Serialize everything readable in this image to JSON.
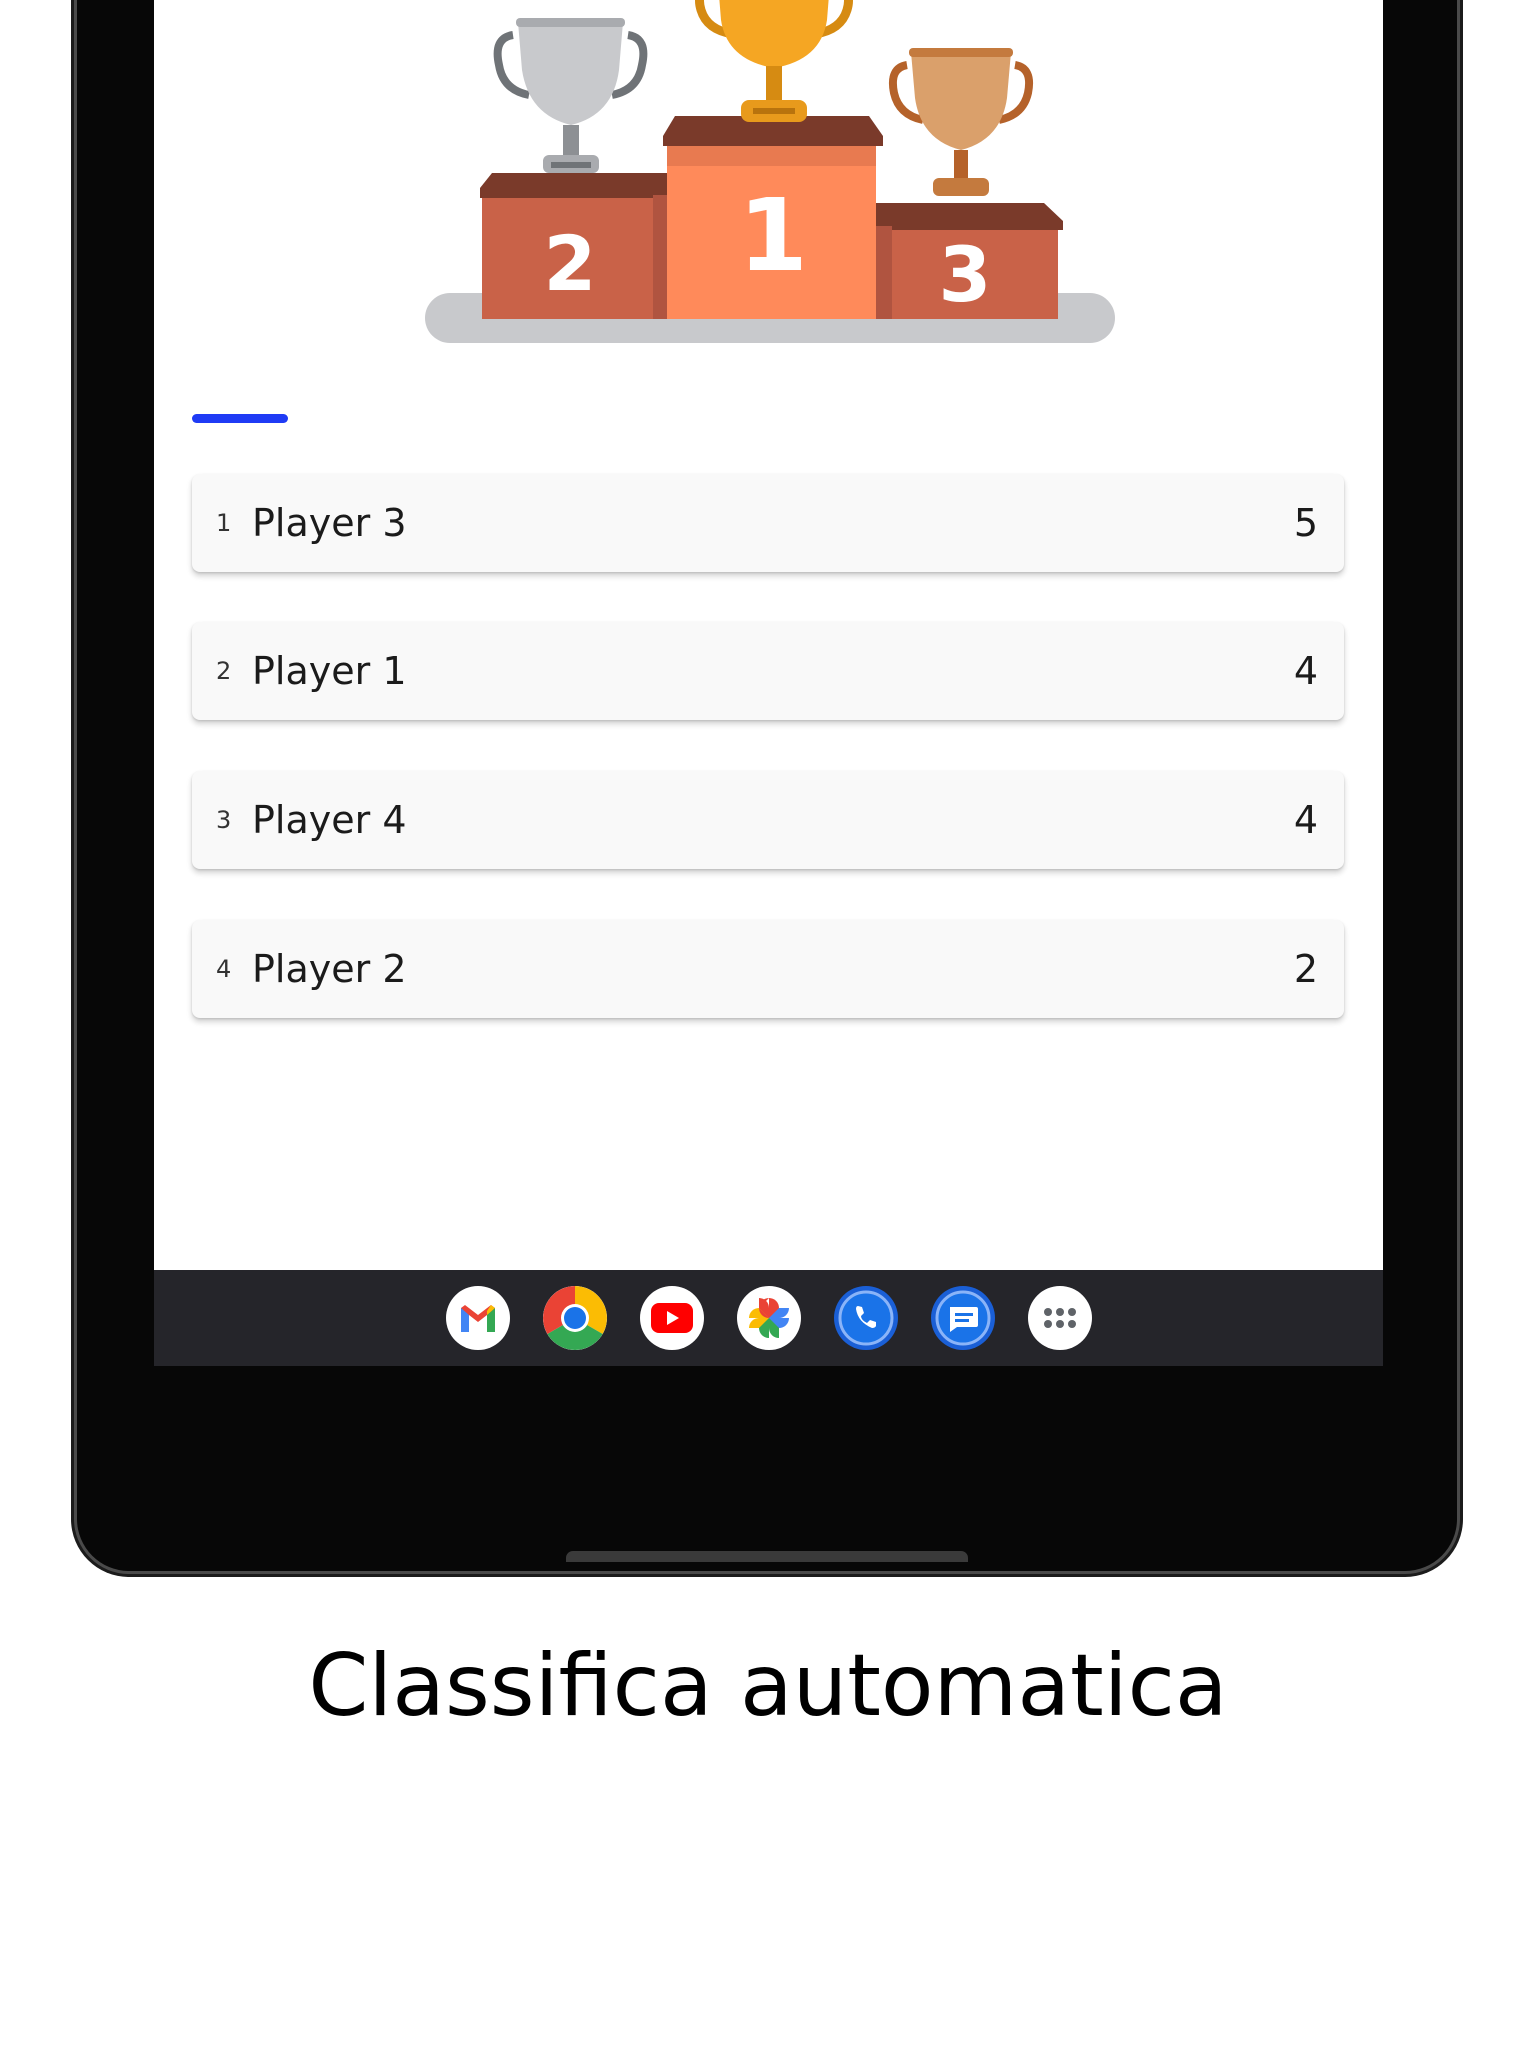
{
  "leaderboard": {
    "rows": [
      {
        "rank": "1",
        "name": "Player 3",
        "score": "5"
      },
      {
        "rank": "2",
        "name": "Player 1",
        "score": "4"
      },
      {
        "rank": "3",
        "name": "Player 4",
        "score": "4"
      },
      {
        "rank": "4",
        "name": "Player 2",
        "score": "2"
      }
    ]
  },
  "podium": {
    "first_label": "1",
    "second_label": "2",
    "third_label": "3"
  },
  "dock": {
    "icons": [
      "gmail-icon",
      "chrome-icon",
      "youtube-icon",
      "photos-icon",
      "phone-icon",
      "messages-icon",
      "app-drawer-icon"
    ]
  },
  "caption": "Classifica automatica",
  "colors": {
    "accent": "#1f3bf5",
    "gold": "#f5a623",
    "silver": "#c8c9cc",
    "bronze": "#d48a40",
    "podium_first": "#ff8a5a",
    "podium_side": "#c96248"
  }
}
